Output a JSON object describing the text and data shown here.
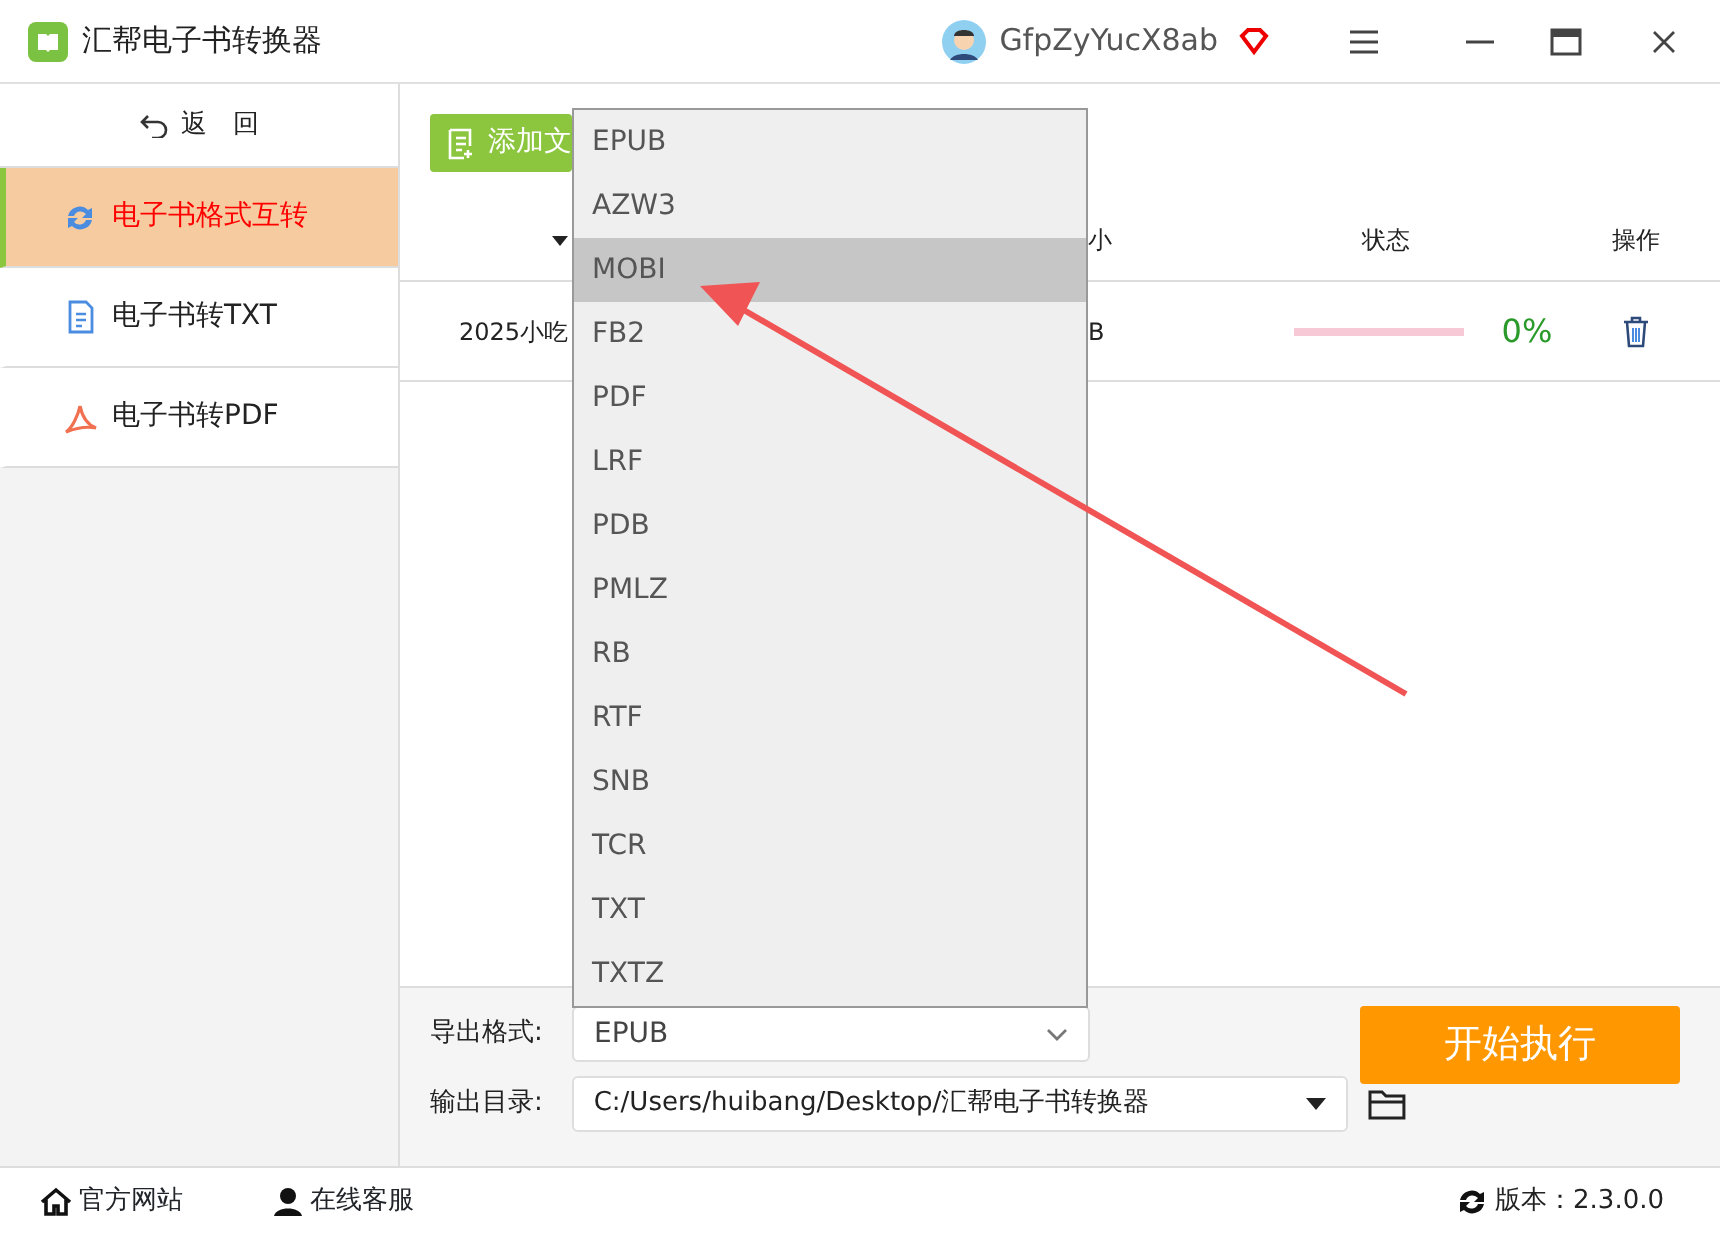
{
  "window": {
    "title": "汇帮电子书转换器",
    "user": "GfpZyYucX8ab"
  },
  "sidebar": {
    "back": "返　回",
    "items": [
      {
        "label": "电子书格式互转",
        "selected": true
      },
      {
        "label": "电子书转TXT",
        "selected": false
      },
      {
        "label": "电子书转PDF",
        "selected": false
      }
    ]
  },
  "toolbar": {
    "add_button": "添加文"
  },
  "table": {
    "columns": [
      "小",
      "状态",
      "操作"
    ],
    "rows": [
      {
        "name": "2025小吃",
        "size": "B",
        "level": 0,
        "percent": "0%"
      }
    ]
  },
  "format_menu": {
    "options": [
      {
        "label": "EPUB",
        "highlighted": false
      },
      {
        "label": "AZW3",
        "highlighted": false
      },
      {
        "label": "MOBI",
        "highlighted": true
      },
      {
        "label": "FB2",
        "highlighted": false
      },
      {
        "label": "PDF",
        "highlighted": false
      },
      {
        "label": "LRF",
        "highlighted": false
      },
      {
        "label": "PDB",
        "highlighted": false
      },
      {
        "label": "PMLZ",
        "highlighted": false
      },
      {
        "label": "RB",
        "highlighted": false
      },
      {
        "label": "RTF",
        "highlighted": false
      },
      {
        "label": "SNB",
        "highlighted": false
      },
      {
        "label": "TCR",
        "highlighted": false
      },
      {
        "label": "TXT",
        "highlighted": false
      },
      {
        "label": "TXTZ",
        "highlighted": false
      }
    ]
  },
  "export": {
    "format_label": "导出格式:",
    "format_value": "EPUB",
    "dir_label": "输出目录:",
    "dir_value": "C:/Users/huibang/Desktop/汇帮电子书转换器",
    "start_button": "开始执行"
  },
  "footer": {
    "links": [
      "官方网站",
      "在线客服"
    ],
    "version": "版本：2.3.0.0"
  }
}
